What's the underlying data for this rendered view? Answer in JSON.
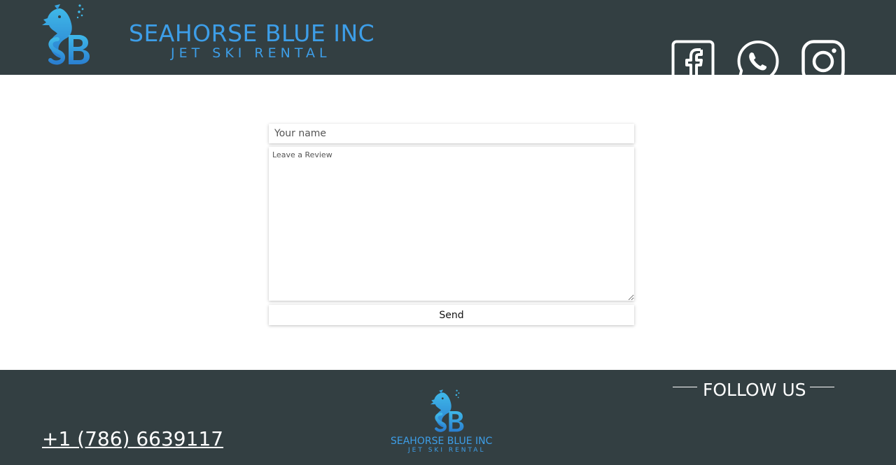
{
  "header": {
    "logo_icon": "seahorse-sb-logo",
    "brand_name": "SEAHORSE BLUE INC",
    "brand_sub": "JET SKI RENTAL"
  },
  "form": {
    "name_placeholder": "Your name",
    "review_placeholder": "Leave a Review",
    "send_label": "Send"
  },
  "footer": {
    "phone": "+1 (786) 6639117",
    "brand_name": "SEAHORSE BLUE INC",
    "brand_sub": "JET SKI RENTAL",
    "follow_title": "FOLLOW US",
    "social": [
      {
        "name": "Facebook",
        "icon": "facebook-icon"
      },
      {
        "name": "WhatsApp",
        "icon": "whatsapp-icon"
      },
      {
        "name": "Instagram",
        "icon": "instagram-icon"
      }
    ]
  },
  "colors": {
    "header_bg": "#333f42",
    "brand_blue": "#3d9ee8",
    "page_bg": "#ffffff"
  }
}
